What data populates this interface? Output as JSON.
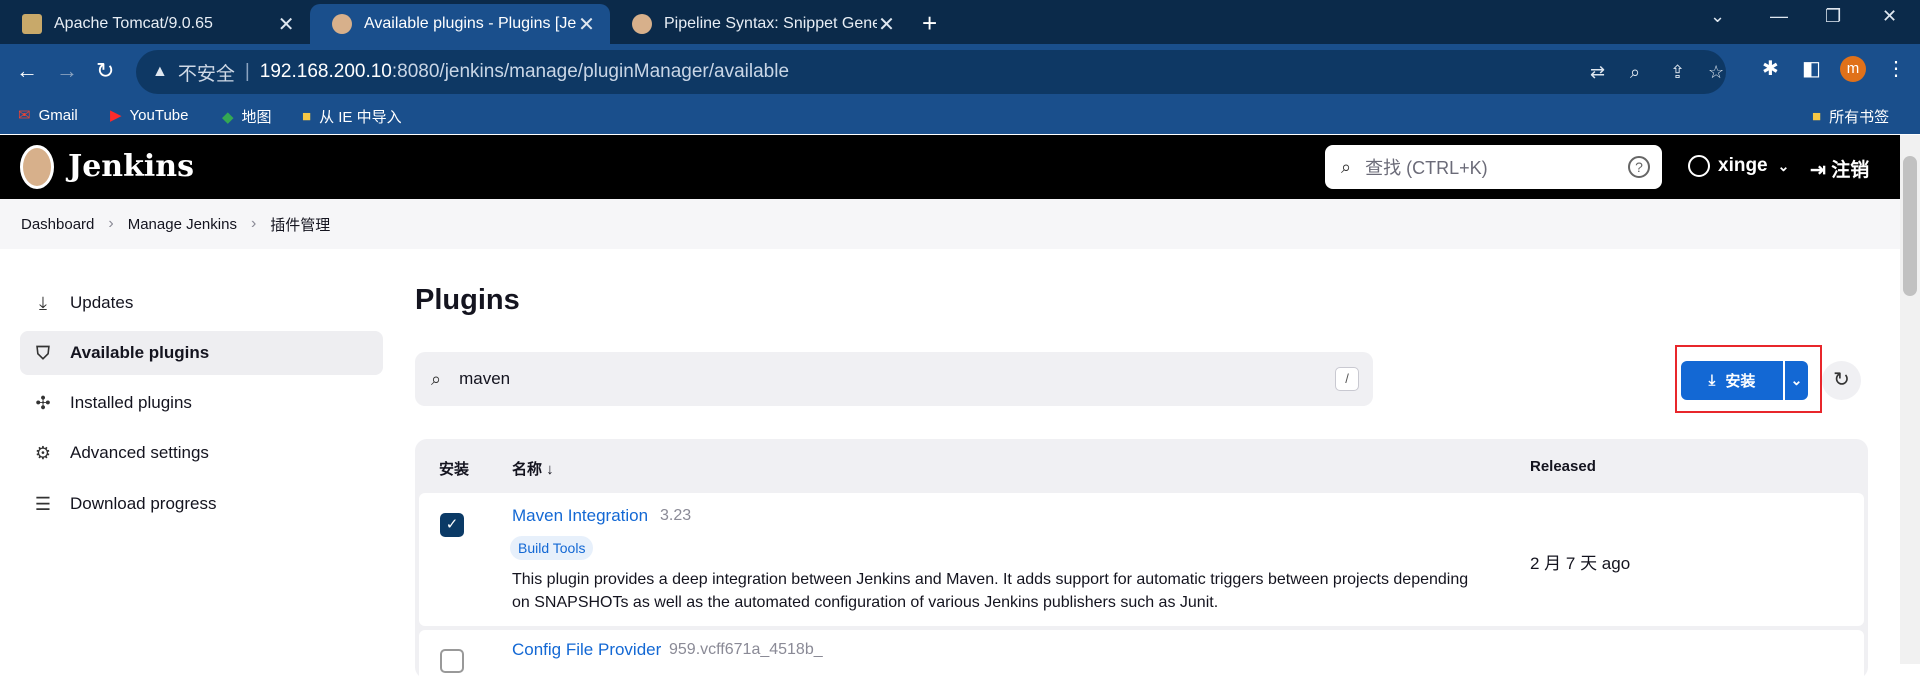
{
  "browser": {
    "tabs": [
      {
        "title": "Apache Tomcat/9.0.65",
        "active": false
      },
      {
        "title": "Available plugins - Plugins [Je",
        "active": true
      },
      {
        "title": "Pipeline Syntax: Snippet Gene",
        "active": false
      }
    ],
    "address": {
      "insecure_label": "不安全",
      "host": "192.168.200.10",
      "path": ":8080/jenkins/manage/pluginManager/available"
    },
    "avatar_letter": "m",
    "bookmarks": [
      "Gmail",
      "YouTube",
      "地图",
      "从 IE 中导入"
    ],
    "all_bookmarks": "所有书签"
  },
  "jenkins": {
    "title": "Jenkins",
    "search_placeholder": "查找 (CTRL+K)",
    "user": "xinge",
    "logout": "注销"
  },
  "breadcrumb": [
    "Dashboard",
    "Manage Jenkins",
    "插件管理"
  ],
  "sidebar": {
    "items": [
      {
        "label": "Updates",
        "icon": "download-icon",
        "active": false
      },
      {
        "label": "Available plugins",
        "icon": "shopping-bag-icon",
        "active": true
      },
      {
        "label": "Installed plugins",
        "icon": "puzzle-icon",
        "active": false
      },
      {
        "label": "Advanced settings",
        "icon": "gear-icon",
        "active": false
      },
      {
        "label": "Download progress",
        "icon": "list-icon",
        "active": false
      }
    ]
  },
  "main": {
    "title": "Plugins",
    "filter_value": "maven",
    "filter_shortcut": "/",
    "install_label": "安装",
    "columns": {
      "install": "安装",
      "name": "名称 ↓",
      "released": "Released"
    },
    "plugins": [
      {
        "name": "Maven Integration",
        "version": "3.23",
        "tag": "Build Tools",
        "description": "This plugin provides a deep integration between Jenkins and Maven. It adds support for automatic triggers between projects depending on SNAPSHOTs as well as the automated configuration of various Jenkins publishers such as Junit.",
        "released": "2 月 7 天 ago",
        "checked": true
      },
      {
        "name": "Config File Provider",
        "version": "959.vcff671a_4518b_",
        "checked": false
      }
    ]
  },
  "colors": {
    "accent": "#1368d4",
    "tabbar": "#0b2a4a",
    "chrome": "#1a4f8c",
    "highlight": "#e8262b"
  }
}
